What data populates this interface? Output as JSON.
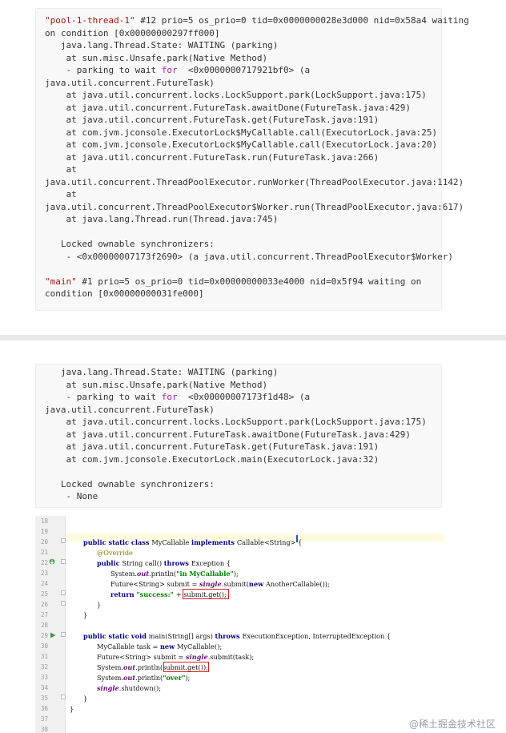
{
  "dump1": {
    "l1": [
      "\"pool-1-thread-1\"",
      " #12 prio=5 os_prio=0 tid=0x0000000028e3d000 nid=0x58a4 waiting"
    ],
    "l2": "on condition [0x00000000297ff000]",
    "l3": "   java.lang.Thread.State: WAITING (parking)",
    "l4": "    at sun.misc.Unsafe.park(Native Method)",
    "l5": [
      "    - parking to wait ",
      "for",
      "  <0x0000000717921bf0> (a"
    ],
    "l6": "java.util.concurrent.FutureTask)",
    "l7": "    at java.util.concurrent.locks.LockSupport.park(LockSupport.java:175)",
    "l8": "    at java.util.concurrent.FutureTask.awaitDone(FutureTask.java:429)",
    "l9": "    at java.util.concurrent.FutureTask.get(FutureTask.java:191)",
    "l10": "    at com.jvm.jconsole.ExecutorLock$MyCallable.call(ExecutorLock.java:25)",
    "l11": "    at com.jvm.jconsole.ExecutorLock$MyCallable.call(ExecutorLock.java:20)",
    "l12": "    at java.util.concurrent.FutureTask.run(FutureTask.java:266)",
    "l13": "    at",
    "l14": "java.util.concurrent.ThreadPoolExecutor.runWorker(ThreadPoolExecutor.java:1142)",
    "l15": "    at",
    "l16": "java.util.concurrent.ThreadPoolExecutor$Worker.run(ThreadPoolExecutor.java:617)",
    "l17": "    at java.lang.Thread.run(Thread.java:745)",
    "l18": "   Locked ownable synchronizers:",
    "l19": "    - <0x00000007173f2690> (a java.util.concurrent.ThreadPoolExecutor$Worker)",
    "l20": [
      "\"main\"",
      " #1 prio=5 os_prio=0 tid=0x00000000033e4000 nid=0x5f94 waiting on"
    ],
    "l21": "condition [0x00000000031fe000]"
  },
  "dump2": {
    "l1": "   java.lang.Thread.State: WAITING (parking)",
    "l2": "    at sun.misc.Unsafe.park(Native Method)",
    "l3": [
      "    - parking to wait ",
      "for",
      "  <0x00000007173f1d48> (a"
    ],
    "l4": "java.util.concurrent.FutureTask)",
    "l5": "    at java.util.concurrent.locks.LockSupport.park(LockSupport.java:175)",
    "l6": "    at java.util.concurrent.FutureTask.awaitDone(FutureTask.java:429)",
    "l7": "    at java.util.concurrent.FutureTask.get(FutureTask.java:191)",
    "l8": "    at com.jvm.jconsole.ExecutorLock.main(ExecutorLock.java:32)",
    "l9": "   Locked ownable synchronizers:",
    "l10": "    - None"
  },
  "ide": {
    "line_numbers": [
      "18",
      "19",
      "20",
      "21",
      "22",
      "23",
      "24",
      "25",
      "26",
      "27",
      "28",
      "29",
      "30",
      "31",
      "32",
      "33",
      "34",
      "35",
      "36",
      "37",
      "38"
    ],
    "c20": [
      "public static class ",
      "MyCallable ",
      "implements ",
      "Callable<String> {"
    ],
    "c21": "@Override",
    "c22": [
      "public ",
      "String call() ",
      "throws ",
      "Exception {"
    ],
    "c23": [
      "System.",
      "out",
      ".println(",
      "\"in MyCallable\"",
      ");"
    ],
    "c24": [
      "Future<String> submit = ",
      "single",
      ".submit(",
      "new ",
      "AnotherCallable());"
    ],
    "c25": [
      "return ",
      "\"success:\" ",
      "+ ",
      "submit.get()",
      ";"
    ],
    "c26": "}",
    "c27": "}",
    "c29": [
      "public static void ",
      "main(String[] args) ",
      "throws ",
      "ExecutionException, InterruptedException {"
    ],
    "c30": [
      "MyCallable task = ",
      "new ",
      "MyCallable();"
    ],
    "c31": [
      "Future<String> submit = ",
      "single",
      ".submit(task);"
    ],
    "c32": [
      "System.",
      "out",
      ".println(",
      "submit.get()",
      ");"
    ],
    "c33": [
      "System.",
      "out",
      ".println(",
      "\"over\"",
      ");"
    ],
    "c34": [
      "single",
      ".shutdown();"
    ],
    "c35": "}",
    "c36": "}"
  },
  "watermark": "@稀土掘金技术社区",
  "colors": {
    "string": "#a31515",
    "number": "#0b7a75",
    "keyword": "#a626a4",
    "highlight_box": "#e11d1d"
  }
}
